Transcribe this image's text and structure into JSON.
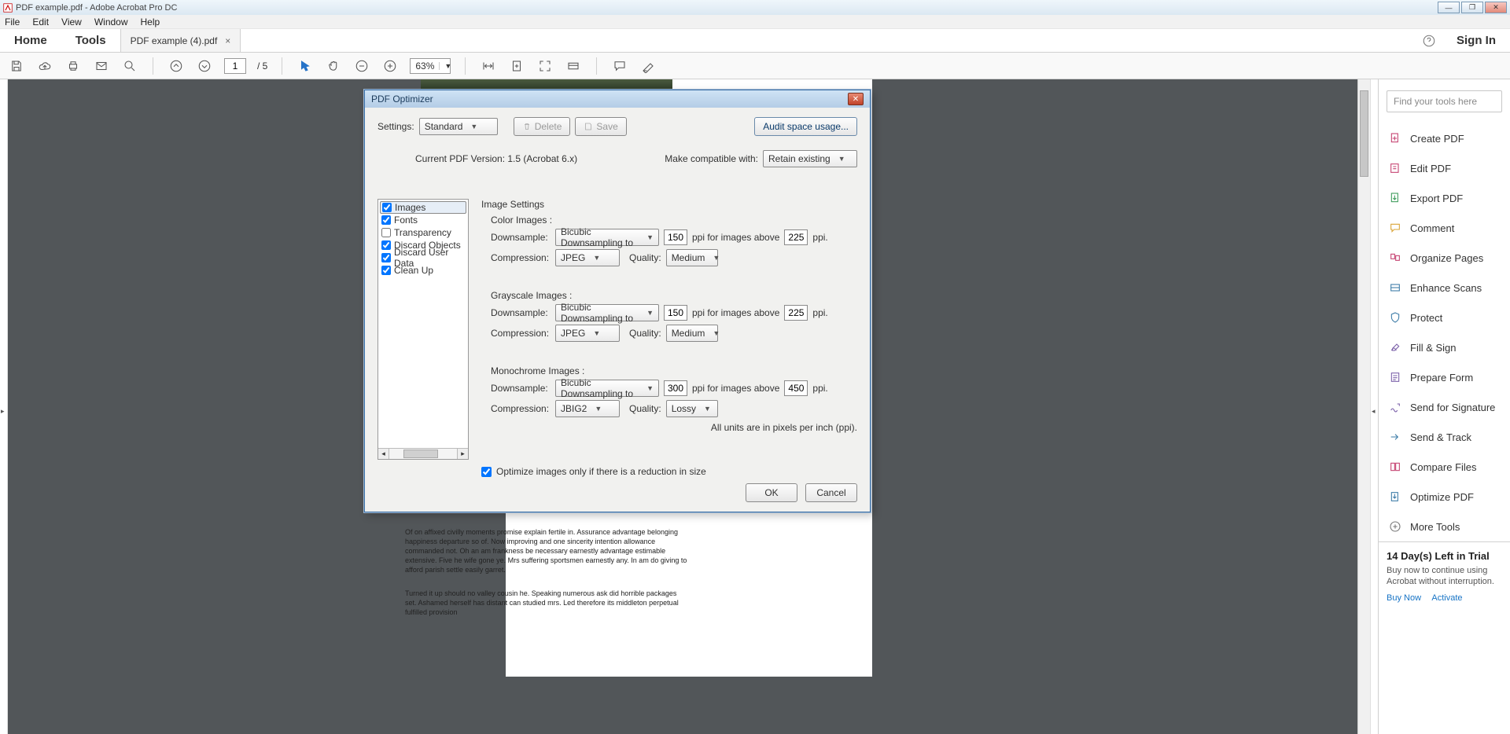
{
  "title": "PDF example.pdf - Adobe Acrobat Pro DC",
  "menus": [
    "File",
    "Edit",
    "View",
    "Window",
    "Help"
  ],
  "tabs": {
    "home": "Home",
    "tools": "Tools",
    "doc": "PDF example (4).pdf",
    "signin": "Sign In"
  },
  "toolbar": {
    "page_current": "1",
    "page_total": "/ 5",
    "zoom": "63%"
  },
  "doc": {
    "para1": "Of on affixed civilly moments promise explain fertile in. Assurance advantage belonging happiness departure so of. Now improving and one sincerity intention allowance commanded not. Oh an am frankness be necessary earnestly advantage estimable extensive. Five he wife gone ye. Mrs suffering sportsmen earnestly any. In am do giving to afford parish settle easily garret.",
    "para2": "Turned it up should no valley cousin he. Speaking numerous ask did horrible packages set. Ashamed herself has distant can studied mrs. Led therefore its middleton perpetual fulfilled provision"
  },
  "rightpanel": {
    "search_placeholder": "Find your tools here",
    "items": [
      "Create PDF",
      "Edit PDF",
      "Export PDF",
      "Comment",
      "Organize Pages",
      "Enhance Scans",
      "Protect",
      "Fill & Sign",
      "Prepare Form",
      "Send for Signature",
      "Send & Track",
      "Compare Files",
      "Optimize PDF",
      "More Tools"
    ],
    "trial_title": "14 Day(s) Left in Trial",
    "trial_body": "Buy now to continue using Acrobat without interruption.",
    "buy": "Buy Now",
    "activate": "Activate"
  },
  "dialog": {
    "title": "PDF Optimizer",
    "settings_label": "Settings:",
    "settings_value": "Standard",
    "delete": "Delete",
    "save": "Save",
    "audit": "Audit space usage...",
    "current_version": "Current PDF Version: 1.5 (Acrobat 6.x)",
    "compatible_label": "Make compatible with:",
    "compatible_value": "Retain existing",
    "categories": [
      {
        "label": "Images",
        "checked": true,
        "selected": true
      },
      {
        "label": "Fonts",
        "checked": true
      },
      {
        "label": "Transparency",
        "checked": false
      },
      {
        "label": "Discard Objects",
        "checked": true
      },
      {
        "label": "Discard User Data",
        "checked": true
      },
      {
        "label": "Clean Up",
        "checked": true
      }
    ],
    "panel_title": "Image Settings",
    "section_color": "Color Images :",
    "section_gray": "Grayscale Images :",
    "section_mono": "Monochrome Images :",
    "lbl_downsample": "Downsample:",
    "lbl_compression": "Compression:",
    "lbl_quality": "Quality:",
    "lbl_ppi_above": "ppi for images above",
    "lbl_ppi": "ppi.",
    "downsample_method": "Bicubic Downsampling to",
    "compression_jpeg": "JPEG",
    "compression_jbig2": "JBIG2",
    "quality_medium": "Medium",
    "quality_lossy": "Lossy",
    "color_ppi": "150",
    "color_above": "225",
    "gray_ppi": "150",
    "gray_above": "225",
    "mono_ppi": "300",
    "mono_above": "450",
    "units_note": "All units are in pixels per inch (ppi).",
    "optimize_only": "Optimize images only if there is a reduction in size",
    "ok": "OK",
    "cancel": "Cancel"
  }
}
